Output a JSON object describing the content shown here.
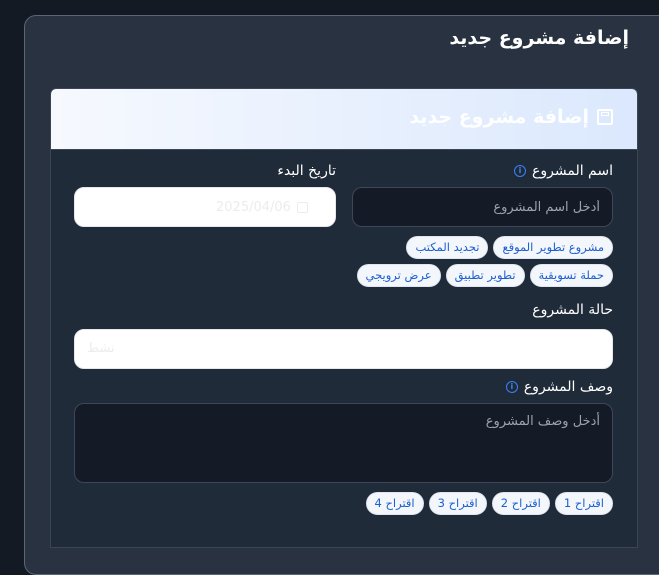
{
  "page": {
    "title": "إضافة مشروع جديد"
  },
  "card": {
    "title": "إضافة مشروع جديد",
    "title_icon": "save-icon"
  },
  "project_name": {
    "label": "اسم المشروع",
    "placeholder": "أدخل اسم المشروع",
    "suggestions": [
      "مشروع تطوير الموقع",
      "تجديد المكتب",
      "حملة تسويقية",
      "تطوير تطبيق",
      "عرض ترويجي"
    ]
  },
  "start_date": {
    "label": "تاريخ البدء",
    "value": "2025/04/06"
  },
  "status": {
    "label": "حالة المشروع",
    "value": "نشط"
  },
  "description": {
    "label": "وصف المشروع",
    "placeholder": "أدخل وصف المشروع",
    "suggestions": [
      "اقتراح 1",
      "اقتراح 2",
      "اقتراح 3",
      "اقتراح 4"
    ]
  },
  "colors": {
    "accent": "#3b82f6",
    "chip_text": "#1d5fd1",
    "panel_bg": "#283241"
  }
}
